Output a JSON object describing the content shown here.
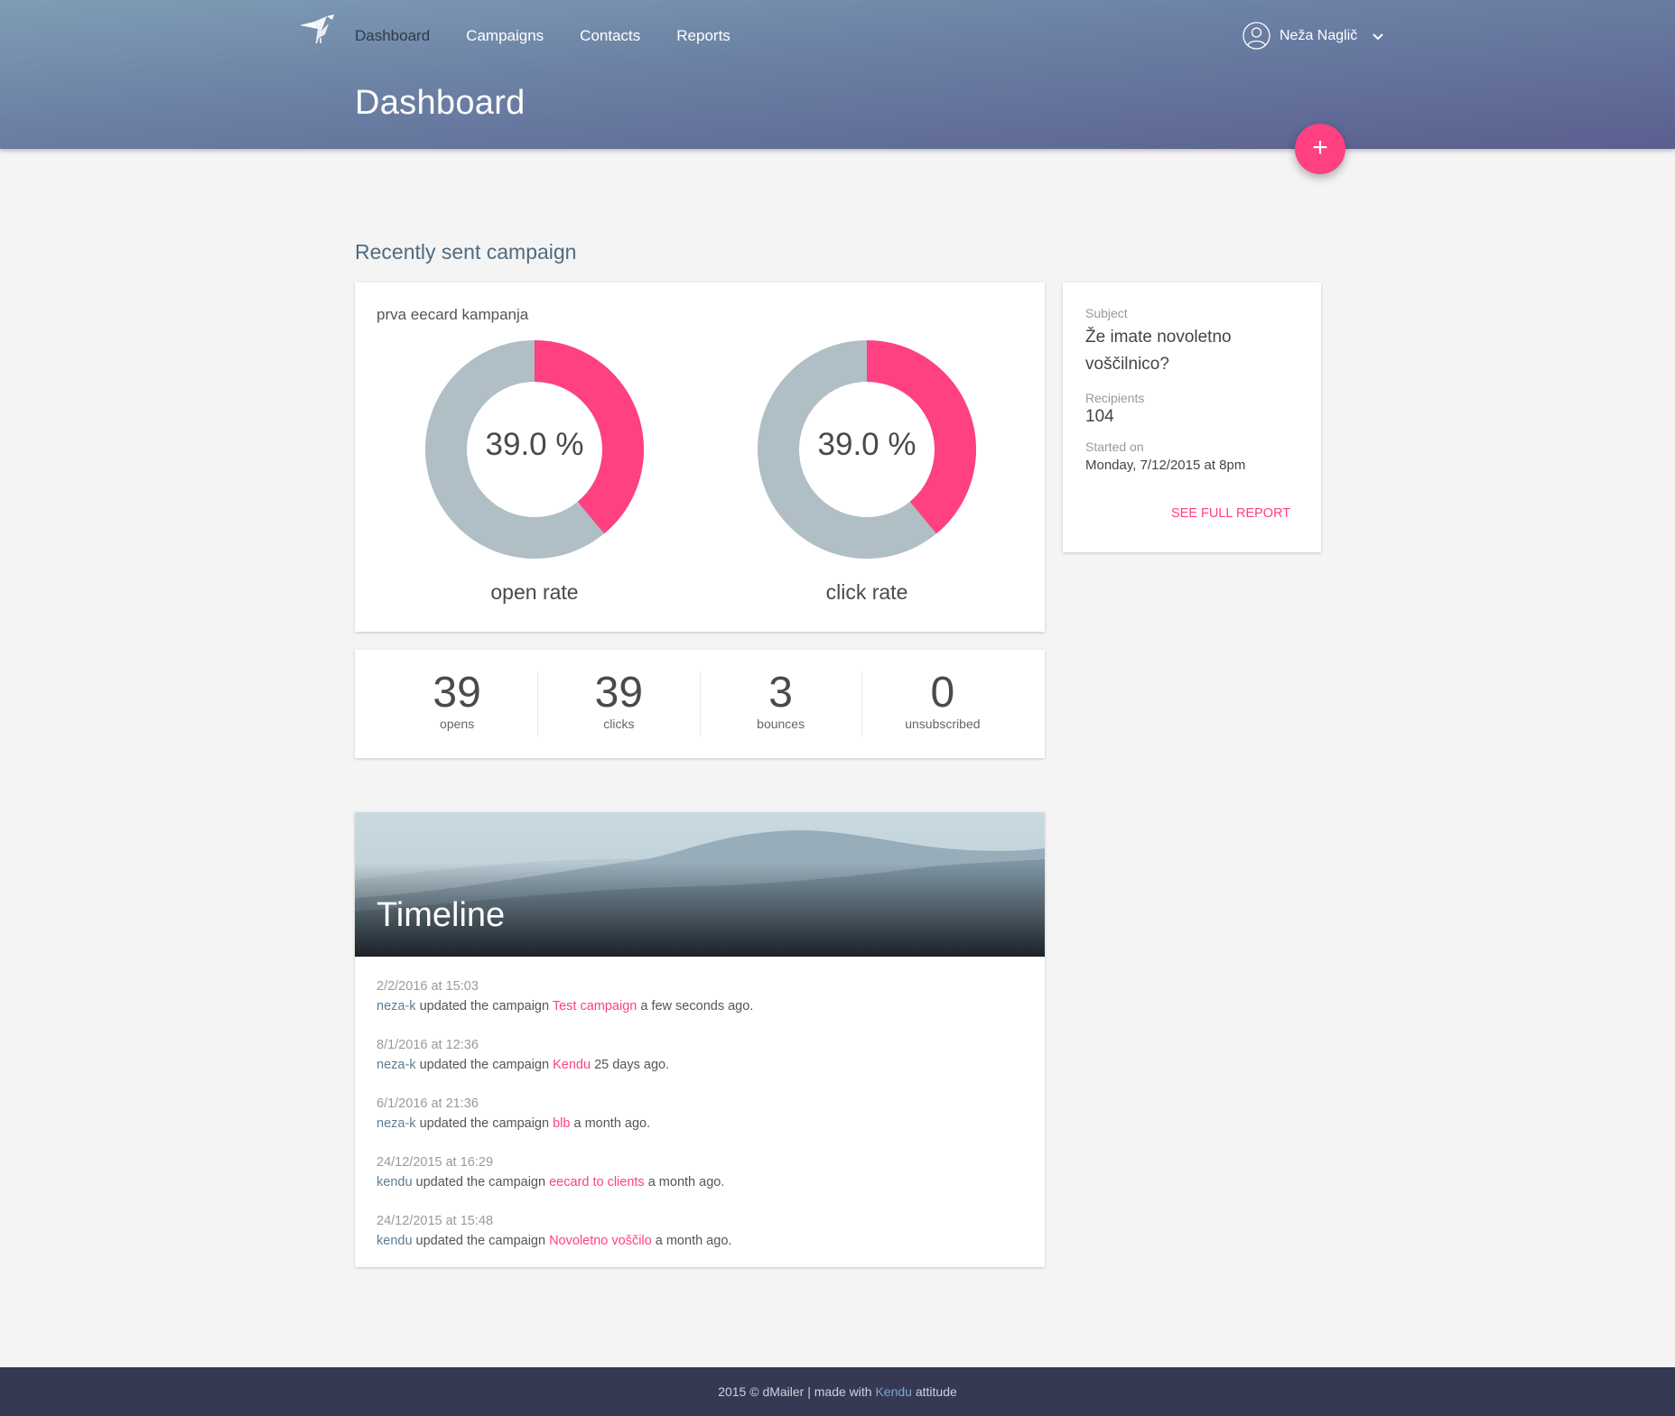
{
  "header": {
    "nav": [
      "Dashboard",
      "Campaigns",
      "Contacts",
      "Reports"
    ],
    "user_name": "Neža Naglič",
    "page_title": "Dashboard",
    "fab_label": "+"
  },
  "section_title": "Recently sent campaign",
  "campaign": {
    "name": "prva eecard kampanja",
    "open_rate": {
      "value": 39.0,
      "display": "39.0 %",
      "label": "open rate"
    },
    "click_rate": {
      "value": 39.0,
      "display": "39.0 %",
      "label": "click rate"
    }
  },
  "stats": [
    {
      "value": "39",
      "label": "opens"
    },
    {
      "value": "39",
      "label": "clicks"
    },
    {
      "value": "3",
      "label": "bounces"
    },
    {
      "value": "0",
      "label": "unsubscribed"
    }
  ],
  "info": {
    "subject_label": "Subject",
    "subject_line1": "Že imate novoletno",
    "subject_line2": "voščilnico?",
    "recipients_label": "Recipients",
    "recipients": "104",
    "started_label": "Started on",
    "started": "Monday, 7/12/2015 at 8pm",
    "report_link": "SEE FULL REPORT"
  },
  "timeline": {
    "title": "Timeline",
    "items": [
      {
        "date": "2/2/2016 at 15:03",
        "user": "neza-k",
        "action": "updated the campaign",
        "campaign": "Test campaign",
        "ago": "a few seconds ago."
      },
      {
        "date": "8/1/2016 at 12:36",
        "user": "neza-k",
        "action": "updated the campaign",
        "campaign": "Kendu",
        "ago": "25 days ago."
      },
      {
        "date": "6/1/2016 at 21:36",
        "user": "neza-k",
        "action": "updated the campaign",
        "campaign": "blb",
        "ago": "a month ago."
      },
      {
        "date": "24/12/2015 at 16:29",
        "user": "kendu",
        "action": "updated the campaign",
        "campaign": "eecard to clients",
        "ago": "a month ago."
      },
      {
        "date": "24/12/2015 at 15:48",
        "user": "kendu",
        "action": "updated the campaign",
        "campaign": "Novoletno voščilo",
        "ago": "a month ago."
      }
    ]
  },
  "footer": {
    "prefix": "2015 © dMailer | made with",
    "link": "Kendu",
    "suffix": "attitude"
  },
  "colors": {
    "accent": "#ff4081",
    "donut_rest": "#b0bec5",
    "footer_bg": "#353a52"
  }
}
